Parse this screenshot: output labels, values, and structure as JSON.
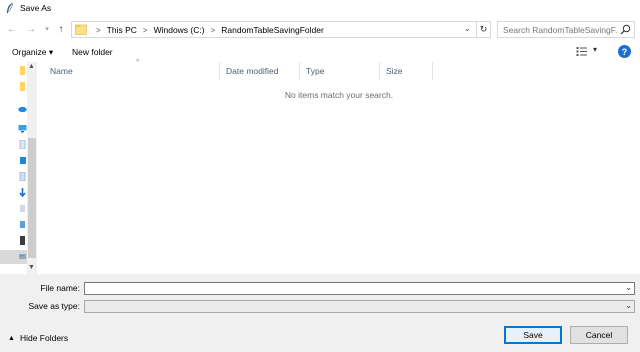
{
  "window": {
    "title": "Save As"
  },
  "address": {
    "crumbs": [
      "This PC",
      "Windows (C:)",
      "RandomTableSavingFolder"
    ],
    "search_placeholder": "Search RandomTableSavingF..."
  },
  "toolbar": {
    "organize_label": "Organize ▾",
    "new_folder_label": "New folder"
  },
  "columns": [
    "Name",
    "Date modified",
    "Type",
    "Size"
  ],
  "file_list": {
    "empty_message": "No items match your search."
  },
  "form": {
    "file_name_label": "File name:",
    "file_name_value": "",
    "save_as_type_label": "Save as type:",
    "save_as_type_value": ""
  },
  "footer": {
    "hide_folders_label": "Hide Folders",
    "save_label": "Save",
    "cancel_label": "Cancel"
  },
  "colors": {
    "accent": "#0078d7",
    "help": "#1a6fd0",
    "header_text": "#4c607a"
  }
}
